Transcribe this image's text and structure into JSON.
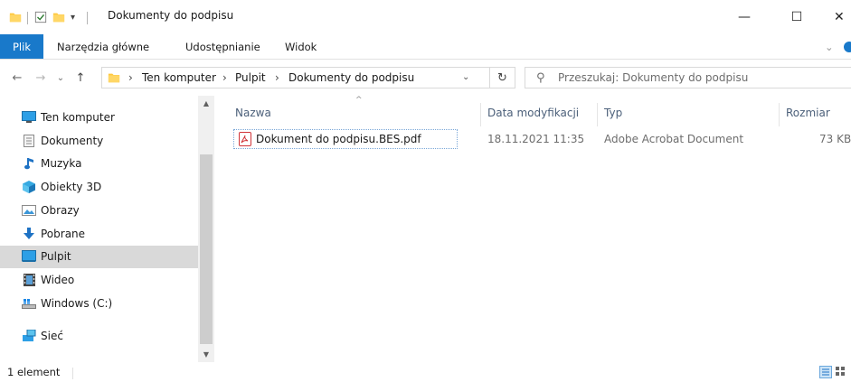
{
  "window": {
    "title": "Dokumenty do podpisu",
    "minimize": "—",
    "maximize": "☐",
    "close": "✕"
  },
  "ribbon": {
    "tabs": [
      "Plik",
      "Narzędzia główne",
      "Udostępnianie",
      "Widok"
    ],
    "expand": "⌄"
  },
  "navigation": {
    "back": "←",
    "forward": "→",
    "recent": "⌄",
    "up": "↑",
    "breadcrumb": [
      "Ten komputer",
      "Pulpit",
      "Dokumenty do podpisu"
    ],
    "crumb_sep": "›",
    "dropdown": "⌄",
    "refresh": "↻"
  },
  "search": {
    "icon": "search-icon",
    "placeholder": "Przeszukaj: Dokumenty do podpisu"
  },
  "sidebar": {
    "items": [
      {
        "label": "Ten komputer",
        "icon": "computer-icon"
      },
      {
        "label": "Dokumenty",
        "icon": "documents-icon"
      },
      {
        "label": "Muzyka",
        "icon": "music-icon"
      },
      {
        "label": "Obiekty 3D",
        "icon": "objects-3d-icon"
      },
      {
        "label": "Obrazy",
        "icon": "pictures-icon"
      },
      {
        "label": "Pobrane",
        "icon": "downloads-icon"
      },
      {
        "label": "Pulpit",
        "icon": "desktop-icon",
        "selected": true
      },
      {
        "label": "Wideo",
        "icon": "video-icon"
      },
      {
        "label": "Windows (C:)",
        "icon": "drive-icon"
      },
      {
        "label": "Sieć",
        "icon": "network-icon"
      }
    ]
  },
  "columns": {
    "name": "Nazwa",
    "modified": "Data modyfikacji",
    "type": "Typ",
    "size": "Rozmiar",
    "sort_indicator": "^"
  },
  "files": [
    {
      "name": "Dokument do podpisu.BES.pdf",
      "modified": "18.11.2021 11:35",
      "type": "Adobe Acrobat Document",
      "size": "73 KB",
      "icon": "pdf-icon"
    }
  ],
  "status": {
    "count": "1 element"
  },
  "colors": {
    "accent": "#1979ca",
    "selected_nav": "#d9d9d9",
    "folder": "#ffc83d",
    "column_header": "#4c607a"
  }
}
